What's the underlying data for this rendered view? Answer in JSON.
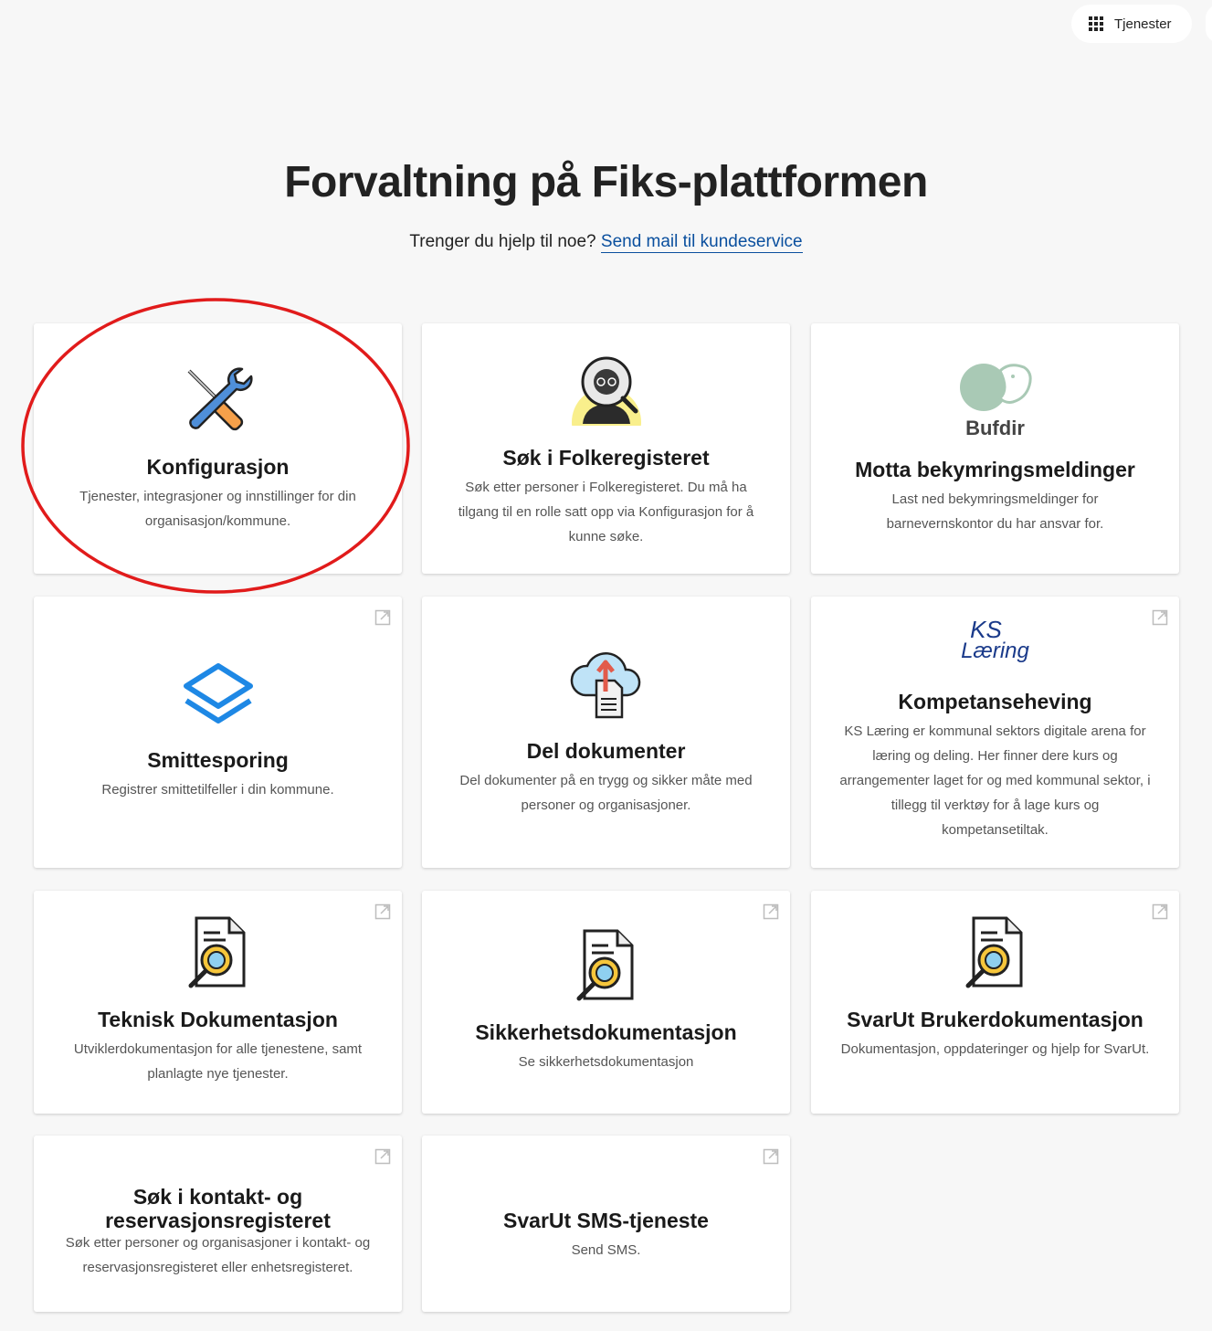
{
  "header": {
    "services_label": "Tjenester"
  },
  "page": {
    "title": "Forvaltning på Fiks-plattformen",
    "help_text": "Trenger du hjelp til noe?",
    "help_link": "Send mail til kundeservice"
  },
  "cards": [
    {
      "title": "Konfigurasjon",
      "desc": "Tjenester, integrasjoner og innstillinger for din organisasjon/kommune.",
      "icon": "tools-icon",
      "external": false
    },
    {
      "title": "Søk i Folkeregisteret",
      "desc": "Søk etter personer i Folkeregisteret. Du må ha tilgang til en rolle satt opp via Konfigurasjon for å kunne søke.",
      "icon": "person-search-icon",
      "external": false
    },
    {
      "title": "Motta bekymringsmeldinger",
      "desc": "Last ned bekymringsmeldinger for barnevernskontor du har ansvar for.",
      "icon": "bufdir-logo",
      "logo_text": "Bufdir",
      "external": false
    },
    {
      "title": "Smittesporing",
      "desc": "Registrer smittetilfeller i din kommune.",
      "icon": "layers-icon",
      "external": true
    },
    {
      "title": "Del dokumenter",
      "desc": "Del dokumenter på en trygg og sikker måte med personer og organisasjoner.",
      "icon": "cloud-upload-document-icon",
      "external": false
    },
    {
      "title": "Kompetanseheving",
      "desc": "KS Læring er kommunal sektors digitale arena for læring og deling. Her finner dere kurs og arrangementer laget for og med kommunal sektor, i tillegg til verktøy for å lage kurs og kompetansetiltak.",
      "icon": "ks-laering-logo",
      "logo_line1": "KS",
      "logo_line2": "Læring",
      "external": true
    },
    {
      "title": "Teknisk Dokumentasjon",
      "desc": "Utviklerdokumentasjon for alle tjenestene, samt planlagte nye tjenester.",
      "icon": "document-code-search-icon",
      "external": true
    },
    {
      "title": "Sikkerhetsdokumentasjon",
      "desc": "Se sikkerhetsdokumentasjon",
      "icon": "document-code-search-icon",
      "external": true
    },
    {
      "title": "SvarUt Brukerdokumentasjon",
      "desc": "Dokumentasjon, oppdateringer og hjelp for SvarUt.",
      "icon": "document-code-search-icon",
      "external": true
    },
    {
      "title": "Søk i kontakt- og reservasjonsregisteret",
      "desc": "Søk etter personer og organisasjoner i kontakt- og reservasjonsregisteret eller enhetsregisteret.",
      "icon": "none",
      "external": true
    },
    {
      "title": "SvarUt SMS-tjeneste",
      "desc": "Send SMS.",
      "icon": "none",
      "external": true
    }
  ],
  "colors": {
    "accent_link": "#0a4f9e",
    "highlight_circle": "#e11b1b",
    "smitte_blue": "#1e88e5",
    "bufdir_green": "#a9c9b5",
    "ks_blue": "#1a3a8a"
  }
}
